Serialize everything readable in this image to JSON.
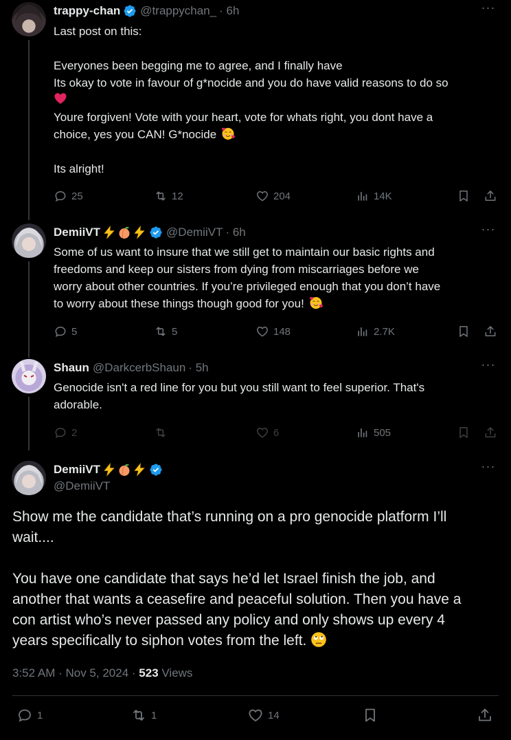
{
  "tweets": [
    {
      "display_name": "trappy-chan",
      "handle": "@trappychan_",
      "time": "· 6h",
      "lines": [
        "Last post on this:",
        "",
        "Everyones been begging me to agree, and I finally have",
        "Its okay to vote in favour of g*nocide and you do have valid reasons to do so",
        "[heart]",
        "Youre forgiven! Vote with your heart, vote for whats right, you dont have a",
        "choice, yes you CAN! G*nocide [smile]",
        "",
        "Its alright!"
      ],
      "line1": "Last post on this:",
      "line2": "Everyones been begging me to agree, and I finally have",
      "line3": "Its okay to vote in favour of g*nocide and you do have valid reasons to do so",
      "line4": "Youre forgiven! Vote with your heart, vote for whats right, you dont have a",
      "line5": "choice, yes you CAN! G*nocide",
      "line6": "Its alright!",
      "replies": "25",
      "reposts": "12",
      "likes": "204",
      "views": "14K"
    },
    {
      "display_name": "DemiiVT",
      "handle": "@DemiiVT",
      "time": "· 6h",
      "line1": "Some of us want to insure that we still get to maintain our basic rights and",
      "line2": "freedoms and keep our sisters from dying from miscarriages before we",
      "line3": "worry about other countries. If you’re privileged enough that you don’t have",
      "line4": "to worry about these things though good for you!",
      "replies": "5",
      "reposts": "5",
      "likes": "148",
      "views": "2.7K"
    },
    {
      "display_name": "Shaun",
      "handle": "@DarkcerbShaun",
      "time": "· 5h",
      "line1": "Genocide isn't a red line for you but you still want to feel superior. That's",
      "line2": "adorable.",
      "replies": "2",
      "reposts": "",
      "likes": "6",
      "views": "505"
    }
  ],
  "main_tweet": {
    "display_name": "DemiiVT",
    "handle": "@DemiiVT",
    "line1": "Show me the candidate that’s running on a pro genocide platform I’ll",
    "line2": "wait....",
    "line3": "You have one candidate that says he’d let Israel finish the job, and",
    "line4": "another that wants a ceasefire and peaceful solution. Then you have a",
    "line5": "con artist who’s never passed any policy and only shows up every 4",
    "line6": "years specifically to siphon votes from the left.",
    "timestamp": "3:52 AM · Nov 5, 2024 ·",
    "views_count": "523",
    "views_label": "Views",
    "replies": "1",
    "reposts": "1",
    "likes": "14"
  },
  "colors": {
    "background": "#000000",
    "text": "#e7e9ea",
    "muted": "#71767b",
    "verified": "#1d9bf0",
    "divider": "#2f3336"
  },
  "icons": [
    "verified-badge-icon",
    "more-icon",
    "reply-icon",
    "repost-icon",
    "like-icon",
    "views-icon",
    "bookmark-icon",
    "share-icon",
    "lightning-emoji",
    "peach-emoji",
    "heart-emoji",
    "smiling-face-with-hearts-emoji",
    "face-with-rolling-eyes-emoji"
  ]
}
